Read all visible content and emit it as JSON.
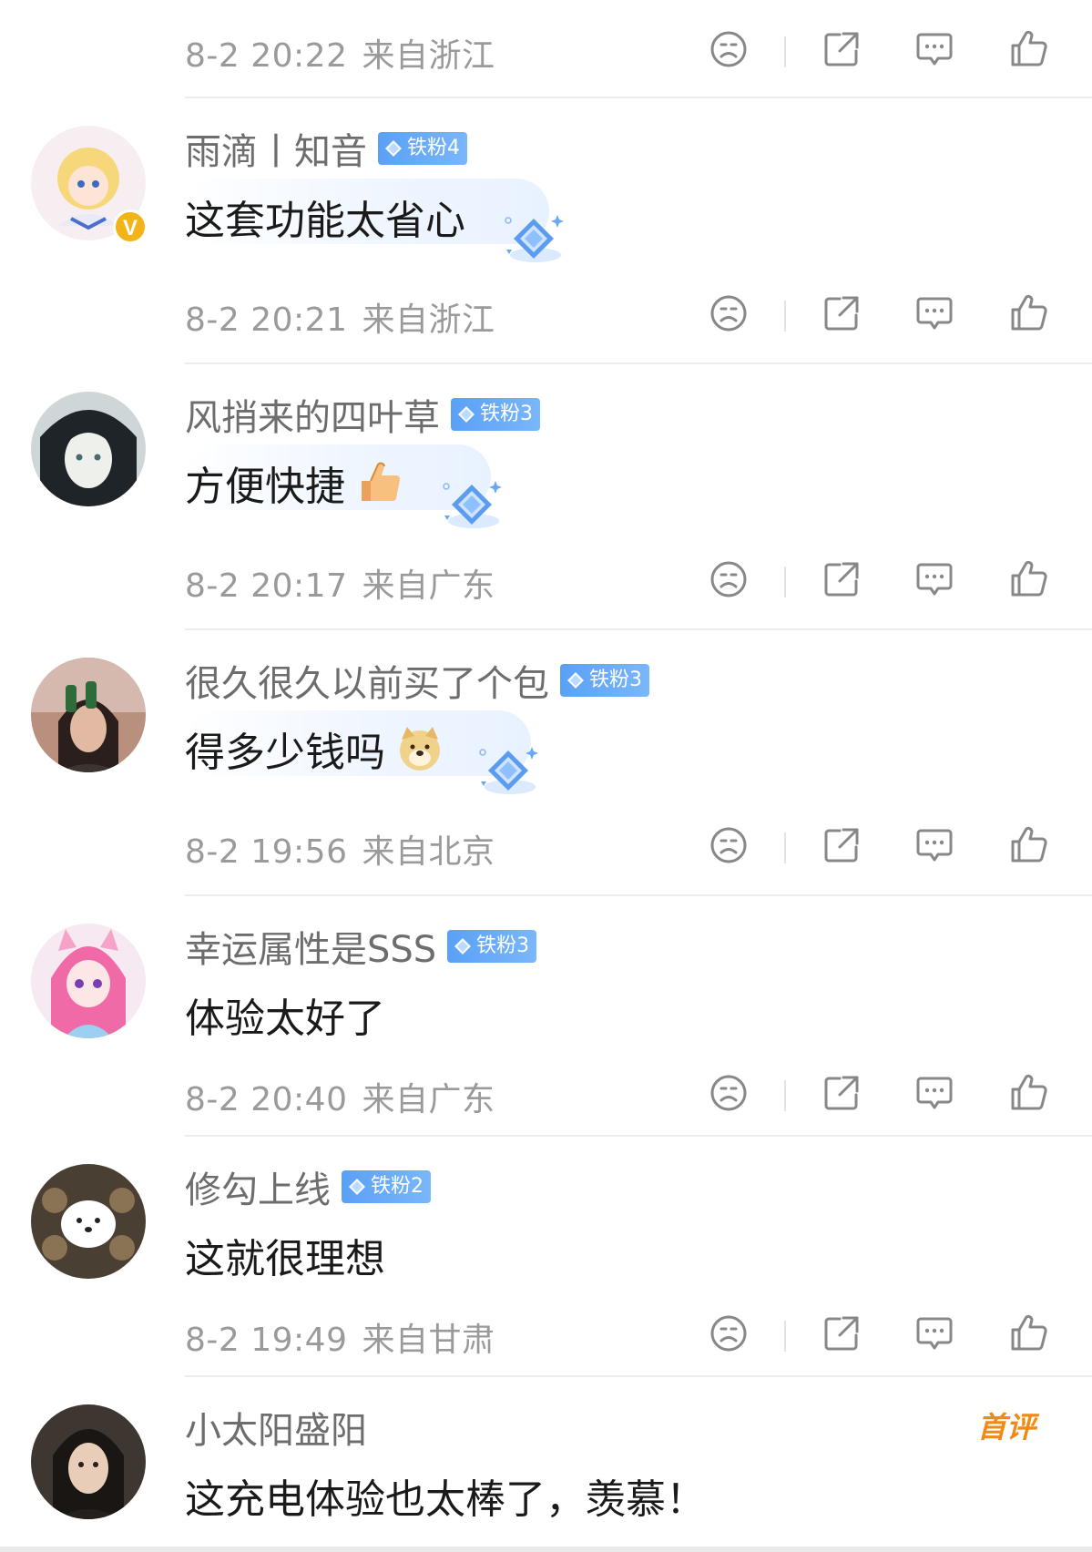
{
  "icons": {
    "dislike": "sad-face-icon",
    "share": "share-icon",
    "reply": "comment-bubble-icon",
    "like": "thumbs-up-icon"
  },
  "colors": {
    "badge": "#5aa0f5",
    "first_comment": "#f08a14",
    "meta_text": "#9a9a9a"
  },
  "top_meta": {
    "time": "8-2 20:22",
    "location": "来自浙江"
  },
  "comments": [
    {
      "username": "雨滴丨知音",
      "badge": "铁粉4",
      "text": "这套功能太省心",
      "time": "8-2 20:21",
      "location": "来自浙江",
      "verified": "V"
    },
    {
      "username": "风捎来的四叶草",
      "badge": "铁粉3",
      "text": "方便快捷",
      "emoji": "thumbs-up-emoji",
      "time": "8-2 20:17",
      "location": "来自广东"
    },
    {
      "username": "很久很久以前买了个包",
      "badge": "铁粉3",
      "text": "得多少钱吗",
      "emoji": "doge-emoji",
      "time": "8-2 19:56",
      "location": "来自北京"
    },
    {
      "username": "幸运属性是SSS",
      "badge": "铁粉3",
      "text": "体验太好了",
      "time": "8-2 20:40",
      "location": "来自广东"
    },
    {
      "username": "修勾上线",
      "badge": "铁粉2",
      "text": "这就很理想",
      "time": "8-2 19:49",
      "location": "来自甘肃"
    },
    {
      "username": "小太阳盛阳",
      "first_label": "首评",
      "text": "这充电体验也太棒了，羡慕！"
    }
  ]
}
